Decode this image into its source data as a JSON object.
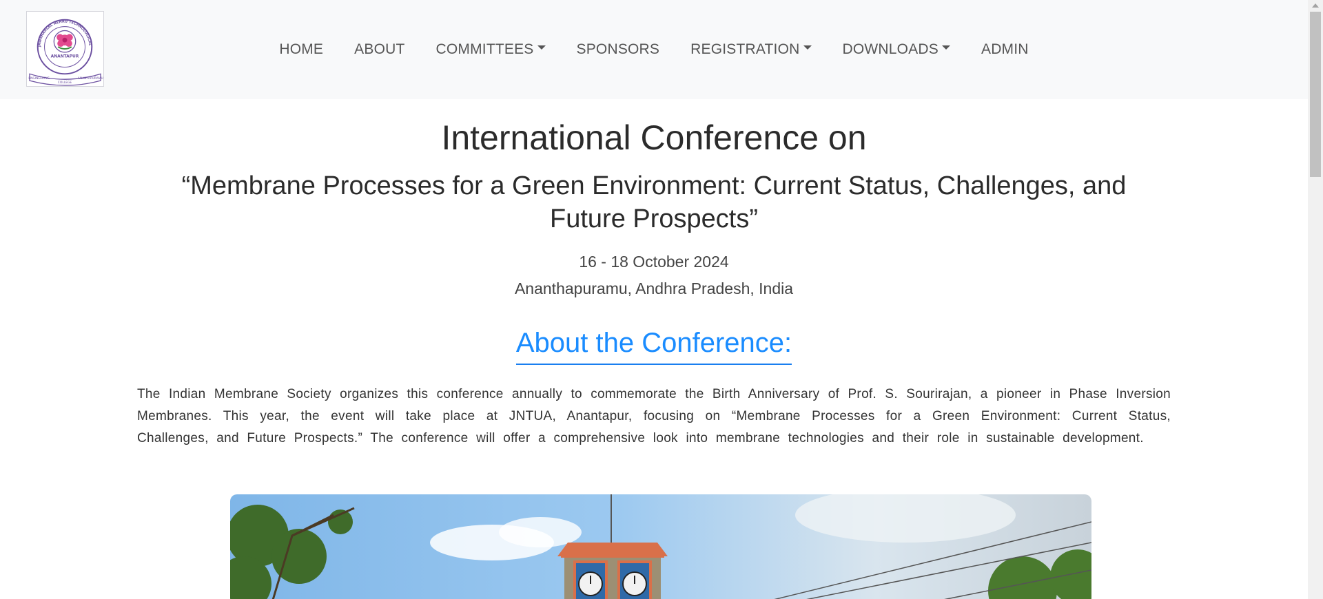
{
  "navbar": {
    "logo_icon": "university-logo-icon",
    "logo": {
      "arc_text": "JAWAHARLAL NEHRU TECHNOLOGICAL UNIVERSITY",
      "city": "ANANTAPUR",
      "ribbon_left": "ENGINEERING",
      "ribbon_center": "COLLEGE",
      "ribbon_right": "ANANTAPURAMU"
    },
    "items": [
      {
        "label": "HOME",
        "dropdown": false
      },
      {
        "label": "ABOUT",
        "dropdown": false
      },
      {
        "label": "COMMITTEES",
        "dropdown": true
      },
      {
        "label": "SPONSORS",
        "dropdown": false
      },
      {
        "label": "REGISTRATION",
        "dropdown": true
      },
      {
        "label": "DOWNLOADS",
        "dropdown": true
      },
      {
        "label": "ADMIN",
        "dropdown": false
      }
    ]
  },
  "hero": {
    "title": "International Conference on",
    "subtitle": "“Membrane Processes for a Green Environment: Current Status, Challenges, and Future Prospects”",
    "date": "16 - 18 October 2024",
    "venue": "Ananthapuramu, Andhra Pradesh, India"
  },
  "about": {
    "heading": "About the Conference:",
    "text": "The Indian Membrane Society organizes this conference annually to commemorate the Birth Anniversary of Prof. S. Sourirajan, a pioneer in Phase Inversion Membranes. This year, the event will take place at JNTUA, Anantapur, focusing on “Membrane Processes for a Green Environment: Current Status, Challenges, and Future Prospects.” The conference will offer a comprehensive look into membrane technologies and their role in sustainable development."
  },
  "photo": {
    "icon": "clock-tower-photo"
  },
  "colors": {
    "accent": "#1a8cff",
    "navbar_bg": "#f8f9fa",
    "nav_text": "#555555"
  }
}
